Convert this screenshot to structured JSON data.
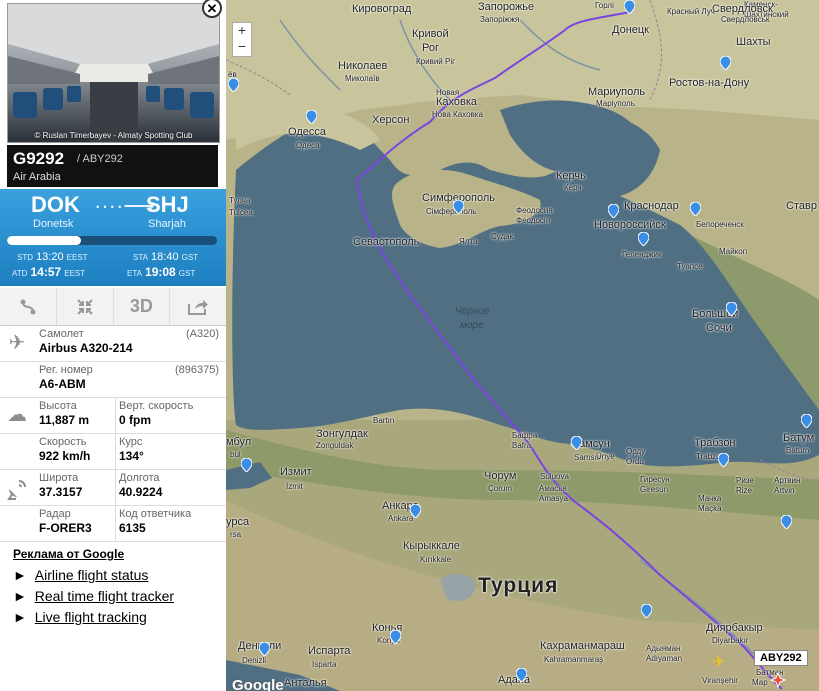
{
  "photo": {
    "credit": "© Ruslan Timerbayev - Almaty Spotting Club"
  },
  "flight": {
    "number": "G9292",
    "callsign": "/ ABY292",
    "airline": "Air Arabia",
    "progress": 0.35
  },
  "route": {
    "from_code": "DOK",
    "from_city": "Donetsk",
    "to_code": "SHJ",
    "to_city": "Sharjah",
    "std_label": "STD",
    "std_value": "13:20",
    "std_tz": "EEST",
    "atd_label": "ATD",
    "atd_value": "14:57",
    "atd_tz": "EEST",
    "sta_label": "STA",
    "sta_value": "18:40",
    "sta_tz": "GST",
    "eta_label": "ETA",
    "eta_value": "19:08",
    "eta_tz": "GST"
  },
  "toolbar": {
    "btn3d": "3D"
  },
  "info": {
    "aircraft_label": "Самолет",
    "aircraft_code": "(A320)",
    "aircraft_value": "Airbus A320-214",
    "reg_label": "Рег. номер",
    "reg_code": "(896375)",
    "reg_value": "A6-ABM",
    "alt_label": "Высота",
    "alt_value": "11,887 m",
    "vs_label": "Верт. скорость",
    "vs_value": "0 fpm",
    "speed_label": "Скорость",
    "speed_value": "922 km/h",
    "course_label": "Курс",
    "course_value": "134°",
    "lat_label": "Широта",
    "lat_value": "37.3157",
    "lon_label": "Долгота",
    "lon_value": "40.9224",
    "radar_label": "Радар",
    "radar_value": "F-ORER3",
    "squawk_label": "Код ответчика",
    "squawk_value": "6135"
  },
  "ads": {
    "header": "Реклама от Google",
    "links": [
      "Airline flight status",
      "Real time flight tracker",
      "Live flight tracking"
    ]
  },
  "map": {
    "flight_tag": "ABY292",
    "country": "Турция",
    "watermark": "Google",
    "sea_ru": "Чёрное",
    "sea_ru2": "море",
    "labels": {
      "kirovograd": "Кировоград",
      "zaporozhye": "Запорожье",
      "zaporizhzhia": "Запоріжжя",
      "gorlovka": "Горлі",
      "donetsk_ru": "Донецк",
      "krivoy_rog": "Кривой",
      "rog": "Рог",
      "kryvyi_rih": "Кривий Ріг",
      "nikolaev": "Николаев",
      "mykolaiv": "Миколаїв",
      "novaya": "Новая",
      "kakhovka": "Каховка",
      "nova_kakhovka": "Нова Каховка",
      "mariupol": "Мариуполь",
      "mariupol_ua": "Маріуполь",
      "rostov": "Ростов-на-Дону",
      "kamensk": "Каменск-",
      "shakhtinsky": "Шахтинский",
      "sverdlovsk": "Свердловск",
      "sverdlovsk_ua": "Свердловськ",
      "krasny_luch": "Красный Луч",
      "shakhty": "Шахты",
      "odessa": "Одесса",
      "odesa_ua": "Одеса",
      "kherson": "Херсон",
      "kerch": "Керчь",
      "kerch_ua": "Керч",
      "simferopol": "Симферополь",
      "simferopol_ua": "Сімферополь",
      "feodosia": "Феодосия",
      "feodosiia": "Феодосія",
      "krasnodar": "Краснодар",
      "stavropol": "Ставр",
      "tulcea_ru": "Тулча",
      "tulcea": "Tulcea",
      "sevastopol": "Севастополь",
      "yalta_ru": "Ялта",
      "yalta_ua": "Ялта",
      "sudak": "Судак",
      "novorossiysk": "Новороссийск",
      "gelendzhik": "Геленджик",
      "belorechensk": "Белореченск",
      "maykop": "Майкоп",
      "tuapse": "Туапсе",
      "bolshoy": "Большой",
      "sochi": "Сочи",
      "bartin": "Bartın",
      "zonguldak_ru": "Зонгулдак",
      "zonguldak": "Zonguldak",
      "bafra_ru": "Бафра",
      "bafra": "Bafra",
      "samsun_ru": "Самсун",
      "samsun": "Samsun",
      "unye": "Ünye",
      "ordu_ru": "Орду",
      "ordu": "Ordu",
      "trabzon_ru": "Трабзон",
      "trabzon": "Trabzon",
      "batumi_ru": "Батум",
      "batumi": "Batum",
      "istanbul_ru": "мбул",
      "istanbul": "bul",
      "izmit_ru": "Измит",
      "izmit": "İzmit",
      "bursa_ru": "урса",
      "bursa": "rsa",
      "ankara_ru": "Анкара",
      "ankara": "Ankara",
      "kirikkale_ru": "Кырыккале",
      "kirikkale": "Kırıkkale",
      "chorum_ru": "Чорум",
      "chorum": "Çorum",
      "amasya_ru": "Амасья",
      "amasya": "Amasya",
      "suluova": "Suluova",
      "giresun_ru": "Гиресун",
      "giresun": "Giresun",
      "rize_ru": "Ризе",
      "rize": "Rize",
      "artvin_ru": "Артвин",
      "artvin": "Artvin",
      "macka_ru": "Мачка",
      "macka": "Maçka",
      "konya_ru": "Конья",
      "konya": "Konya",
      "denizli_ru": "Денизли",
      "denizli": "Denizli",
      "isparta_ru": "Испарта",
      "isparta": "Isparta",
      "antalya_ru": "Анталья",
      "kahramanmaras_ru": "Кахраманмараш",
      "kahramanmaras": "Kahramanmaraş",
      "adiyaman_ru": "Адыяман",
      "adiyaman": "Adıyaman",
      "diyarbakir_ru": "Диярбакыр",
      "diyarbakir": "Diyarbakır",
      "adana_ru": "Адана",
      "viransehir": "Viranşehir",
      "batman_ru": "Батман",
      "mardin_ru": "Мар",
      "gaziantep_ru": "ёв"
    }
  }
}
